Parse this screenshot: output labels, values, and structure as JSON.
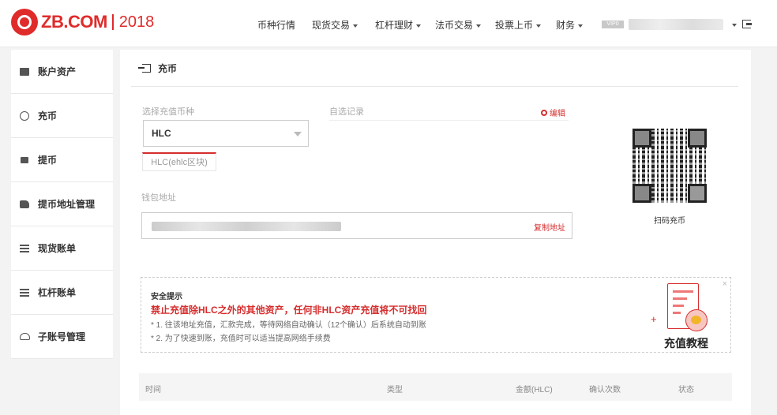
{
  "header": {
    "logo_text": "ZB.COM",
    "logo_year": "2018",
    "nav": [
      {
        "label": "币种行情",
        "has_caret": false
      },
      {
        "label": "现货交易",
        "has_caret": true
      },
      {
        "label": "杠杆理财",
        "has_caret": true
      },
      {
        "label": "法币交易",
        "has_caret": true
      },
      {
        "label": "投票上币",
        "has_caret": true
      },
      {
        "label": "财务",
        "has_caret": true
      }
    ],
    "vip": "VIP0"
  },
  "sidebar": {
    "items": [
      {
        "label": "账户资产",
        "icon": "wallet-icon"
      },
      {
        "label": "充币",
        "icon": "deposit-icon"
      },
      {
        "label": "提币",
        "icon": "withdraw-icon"
      },
      {
        "label": "提币地址管理",
        "icon": "address-book-icon"
      },
      {
        "label": "现货账单",
        "icon": "spot-bill-icon"
      },
      {
        "label": "杠杆账单",
        "icon": "margin-bill-icon"
      },
      {
        "label": "子账号管理",
        "icon": "sub-account-icon"
      }
    ]
  },
  "main": {
    "title": "充币",
    "select_label": "选择充值币种",
    "selected_coin": "HLC",
    "chain_tab": "HLC(ehlc区块)",
    "record_label": "自选记录",
    "edit_label": "编辑",
    "wallet_label": "钱包地址",
    "copy_label": "复制地址",
    "qr_label": "扫码充币"
  },
  "tips": {
    "title": "安全提示",
    "warning": "禁止充值除HLC之外的其他资产，任何非HLC资产充值将不可找回",
    "line1": "* 1. 往该地址充值，汇款完成，等待网络自动确认（12个确认）后系统自动到账",
    "line2": "* 2. 为了快速到账，充值时可以适当提高网络手续费",
    "tutorial_label": "充值教程",
    "close": "×"
  },
  "table": {
    "headers": [
      "时间",
      "类型",
      "金额(HLC)",
      "确认次数",
      "状态"
    ]
  },
  "colors": {
    "brand_red": "#e02b2b",
    "link_red": "#d62d2d"
  }
}
